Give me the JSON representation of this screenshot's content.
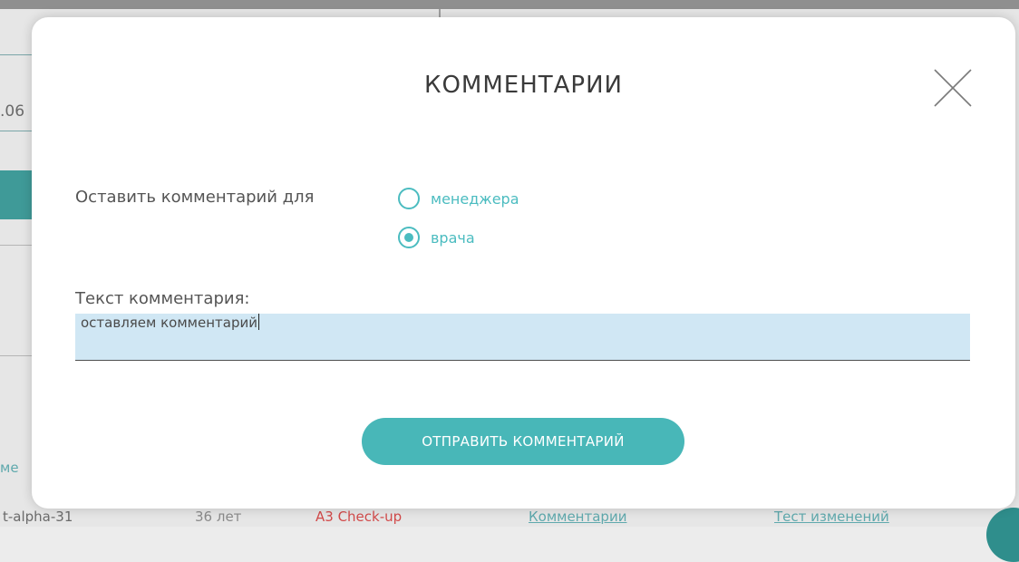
{
  "background": {
    "date_fragment": ".06",
    "column_fragment": "ме",
    "row": {
      "id": "t-alpha-31",
      "age": "36 лет",
      "program": "A3 Check-up",
      "comments_link": "Комментарии",
      "changes_link": "Тест изменений"
    }
  },
  "modal": {
    "title": "КОММЕНТАРИИ",
    "close_icon": "close-icon",
    "recipient_label": "Оставить комментарий для",
    "recipient_options": [
      {
        "label": "менеджера",
        "selected": false
      },
      {
        "label": "врача",
        "selected": true
      }
    ],
    "text_label": "Текст комментария:",
    "comment_value": "оставляем комментарий",
    "submit_label": "ОТПРАВИТЬ КОММЕНТАРИЙ"
  },
  "colors": {
    "accent": "#48b7b8",
    "radio": "#4bbcc0",
    "input_bg": "#d0e7f4",
    "warning_text": "#d24a4a"
  }
}
